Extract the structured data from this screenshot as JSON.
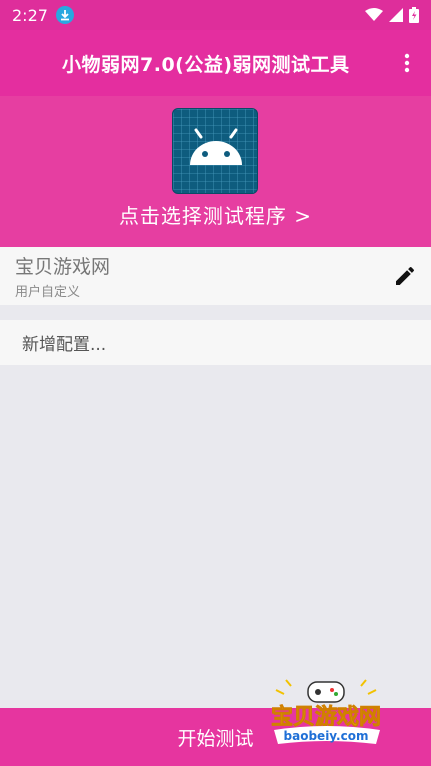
{
  "status_bar": {
    "time": "2:27",
    "icons": [
      "download-icon",
      "wifi-icon",
      "signal-icon",
      "battery-icon"
    ]
  },
  "app_bar": {
    "title": "小物弱网7.0(公益)弱网测试工具",
    "menu_icon": "more-vert-icon"
  },
  "header": {
    "app_icon": "android-icon",
    "select_label": "点击选择测试程序 >"
  },
  "config": {
    "name": "宝贝游戏网",
    "subtitle": "用户自定义",
    "edit_icon": "pencil-icon"
  },
  "add_config_label": "新增配置...",
  "bottom": {
    "start_label": "开始测试"
  },
  "watermark": {
    "text": "宝贝游戏网",
    "url": "baobeiy.com"
  },
  "colors": {
    "primary": "#e42e9f",
    "primary_dark": "#de2e9b",
    "accent_blue": "#29a8e0",
    "background": "#e9e9ee"
  }
}
